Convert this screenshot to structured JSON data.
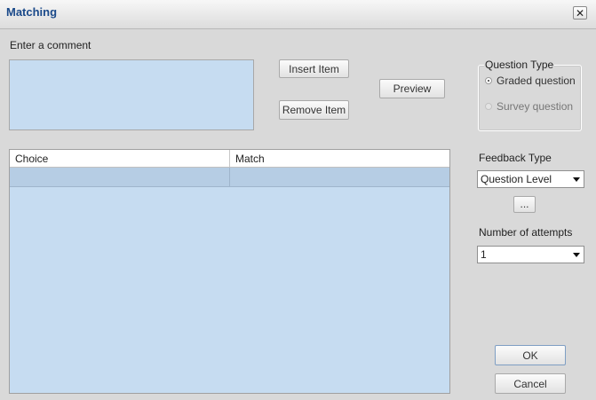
{
  "window": {
    "title": "Matching",
    "close_glyph": "✕"
  },
  "comment": {
    "label": "Enter a comment",
    "value": ""
  },
  "buttons": {
    "insert_item": "Insert Item",
    "remove_item": "Remove Item",
    "preview": "Preview",
    "ellipsis": "...",
    "ok": "OK",
    "cancel": "Cancel"
  },
  "question_type": {
    "label": "Question Type",
    "options": [
      {
        "label": "Graded question",
        "selected": true
      },
      {
        "label": "Survey question",
        "selected": false
      }
    ]
  },
  "grid": {
    "columns": [
      "Choice",
      "Match"
    ],
    "rows": [
      {
        "choice": "",
        "match": ""
      }
    ]
  },
  "feedback_type": {
    "label": "Feedback Type",
    "value": "Question Level"
  },
  "attempts": {
    "label": "Number of attempts",
    "value": "1"
  }
}
